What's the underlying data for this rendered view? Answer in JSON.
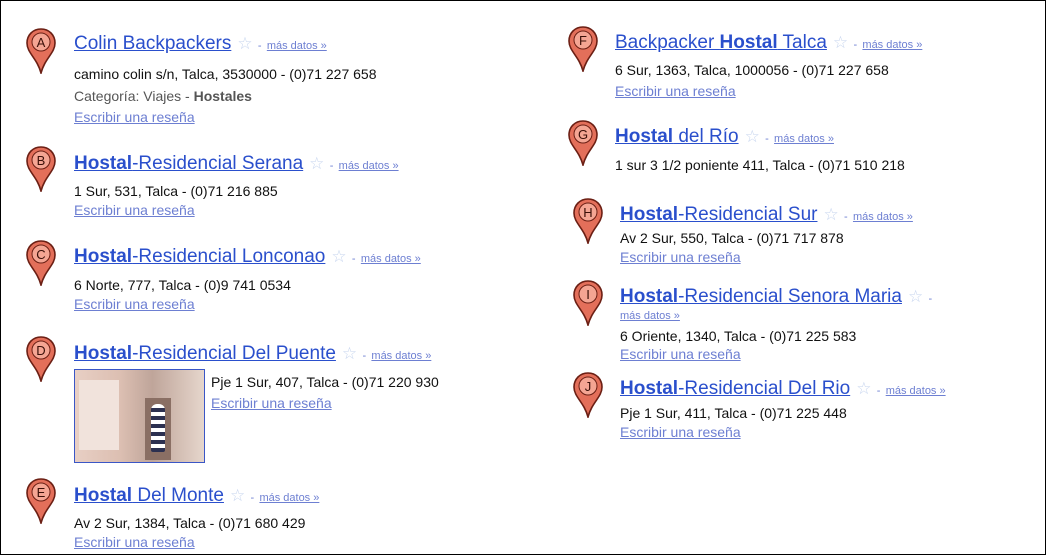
{
  "colors": {
    "link": "#2a4fcc",
    "secondary_link": "#6d7fd2",
    "marker_fill": "#e36f5a",
    "marker_stroke": "#6b1f14",
    "star": "#c8d6ef"
  },
  "icons": {
    "marker": "map-pin-icon",
    "star": "star-outline-icon"
  },
  "separator": "-",
  "more_label": "más datos »",
  "review_label": "Escribir una reseña",
  "listings": [
    {
      "letter": "A",
      "title_plain": "Colin Backpackers",
      "address": "camino colin s/n, Talca, 3530000 - (0)71 227 658",
      "category_prefix": "Categoría: Viajes - ",
      "category_bold": "Hostales"
    },
    {
      "letter": "B",
      "title_bold": "Hostal",
      "title_rest": "-Residencial Serana",
      "address": "1 Sur, 531, Talca - (0)71 216 885"
    },
    {
      "letter": "C",
      "title_bold": "Hostal",
      "title_rest": "-Residencial Lonconao",
      "address": "6 Norte, 777, Talca - (0)9 741 0534"
    },
    {
      "letter": "D",
      "title_bold": "Hostal",
      "title_rest": "-Residencial Del Puente",
      "address": "Pje 1 Sur, 407, Talca - (0)71 220 930"
    },
    {
      "letter": "E",
      "title_bold": "Hostal",
      "title_rest": " Del Monte",
      "address": "Av 2 Sur, 1384, Talca - (0)71 680 429"
    },
    {
      "letter": "F",
      "title_pre": "Backpacker ",
      "title_bold": "Hostal",
      "title_rest": " Talca",
      "address": "6 Sur, 1363, Talca, 1000056 - (0)71 227 658"
    },
    {
      "letter": "G",
      "title_bold": "Hostal",
      "title_rest": " del Río",
      "address": "1 sur 3 1/2 poniente 411, Talca - (0)71 510 218"
    },
    {
      "letter": "H",
      "title_bold": "Hostal",
      "title_rest": "-Residencial Sur",
      "address": "Av 2 Sur, 550, Talca - (0)71 717 878"
    },
    {
      "letter": "I",
      "title_bold": "Hostal",
      "title_rest": "-Residencial Senora Maria",
      "address": "6 Oriente, 1340, Talca - (0)71 225 583"
    },
    {
      "letter": "J",
      "title_bold": "Hostal",
      "title_rest": "-Residencial Del Rio",
      "address": "Pje 1 Sur, 411, Talca - (0)71 225 448"
    }
  ]
}
